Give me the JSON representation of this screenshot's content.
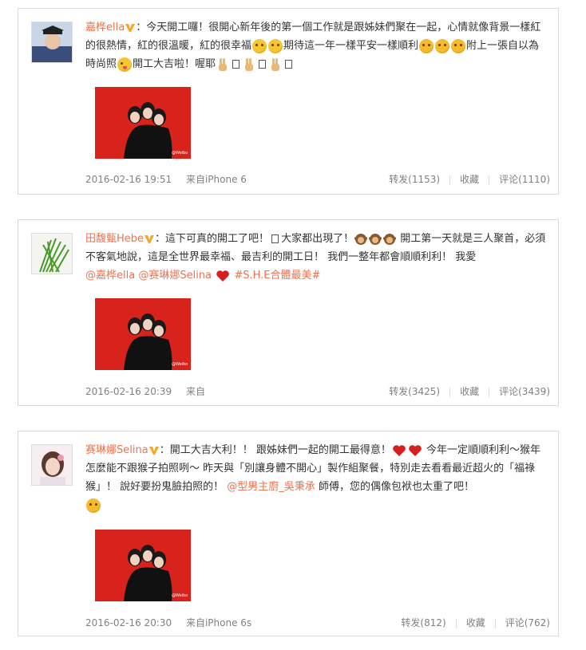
{
  "posts": [
    {
      "author": "嘉桦ella",
      "colon": "：",
      "text_parts": [
        "今天開工囉！很開心新年後的第一個工作就是跟姊妹們聚在一起，心情就像背景一樣紅的很熱情，紅的很溫暖，紅的很幸福",
        "期待這一年一樣平安一樣順利",
        "附上一張自以為時尚照",
        "開工大吉啦！喔耶"
      ],
      "timestamp": "2016-02-16 19:51",
      "source": "来自iPhone 6",
      "actions": {
        "forward": "转发(1153)",
        "favorite": "收藏",
        "comment": "评论(1110)"
      }
    },
    {
      "author": "田馥甄Hebe",
      "colon": "：",
      "text_parts": [
        "這下可真的開工了吧！",
        "大家都出現了！",
        "開工第一天就是三人聚首，必須不客氣地說，這是全世界最幸福、最吉利的開工日！ 我們一整年都會順順利利！ 我愛"
      ],
      "mentions": [
        "@嘉桦ella",
        "@赛琳娜Selina"
      ],
      "topic": "#S.H.E合體最美#",
      "timestamp": "2016-02-16 20:39",
      "source": "来自",
      "actions": {
        "forward": "转发(3425)",
        "favorite": "收藏",
        "comment": "评论(3439)"
      }
    },
    {
      "author": "赛琳娜Selina",
      "colon": "：",
      "text_parts": [
        "開工大吉大利！！ 跟姊妹們一起的開工最得意！",
        "今年一定順順利利～猴年怎麼能不跟猴子拍照咧～ 昨天與「別讓身體不開心」製作組聚餐，特別走去看看最近超火的「福祿猴」！ 說好要扮鬼臉拍照的！",
        "師傅，您的偶像包袱也太重了吧！"
      ],
      "mention": "@型男主廚_吳秉承",
      "timestamp": "2016-02-16 20:30",
      "source": "来自iPhone 6s",
      "actions": {
        "forward": "转发(812)",
        "favorite": "收藏",
        "comment": "评论(762)"
      }
    }
  ],
  "colors": {
    "name": "#eb7350",
    "meta": "#808080",
    "photo_bg": "#d8231d"
  }
}
